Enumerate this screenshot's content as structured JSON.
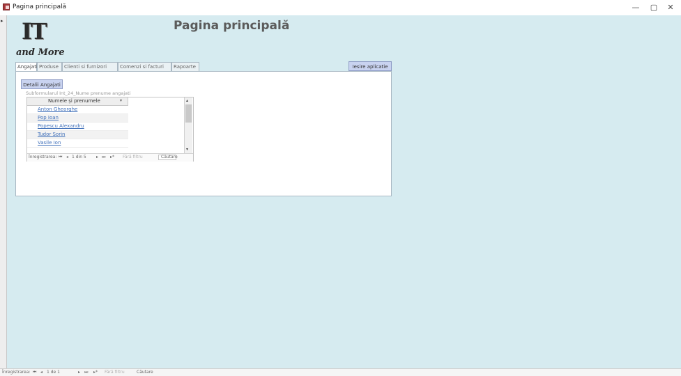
{
  "window": {
    "title": "Pagina principală",
    "controls": {
      "minimize": "—",
      "restore": "▢",
      "close": "✕"
    }
  },
  "record_selector": {
    "arrow": "▸"
  },
  "logo": {
    "line1": "IT",
    "line2": "and More"
  },
  "header": {
    "title": "Pagina principală"
  },
  "tabs": [
    {
      "label": "Angajati",
      "active": true
    },
    {
      "label": "Produse",
      "active": false
    },
    {
      "label": "Clienti si furnizori",
      "active": false
    },
    {
      "label": "Comenzi si facturi",
      "active": false
    },
    {
      "label": "Rapoarte",
      "active": false
    }
  ],
  "exit_button": "Iesire aplicatie",
  "tab_page": {
    "details_button": "Detalii Angajati",
    "subform_label": "Subformularul Int_24_Nume prenume angajati",
    "grid": {
      "column_header": "Numele și prenumele",
      "header_arrow": "▾",
      "rows": [
        "Anton Gheorghe",
        "Pop Ioan",
        "Popescu Alexandru",
        "Tudor Sorin",
        "Vasile Ion"
      ]
    },
    "scroll": {
      "up": "▴",
      "down": "▾"
    },
    "navigation": {
      "record_label": "Înregistrarea:",
      "first": "⏮",
      "prev": "◂",
      "position": "1 din 5",
      "next": "▸",
      "last": "⏭",
      "new": "▸*",
      "filter": "Fără filtru",
      "search": "Căutare"
    }
  },
  "status_bar": {
    "record_label": "Înregistrarea:",
    "first": "⏮",
    "prev": "◂",
    "position": "1 de 1",
    "next": "▸",
    "last": "⏭",
    "new": "▸*",
    "filter": "Fără filtru",
    "search": "Căutare"
  },
  "colors": {
    "background": "#d6ebf0",
    "button": "#c9d3f0",
    "link": "#3f6fb9",
    "app_icon": "#a4373a"
  }
}
